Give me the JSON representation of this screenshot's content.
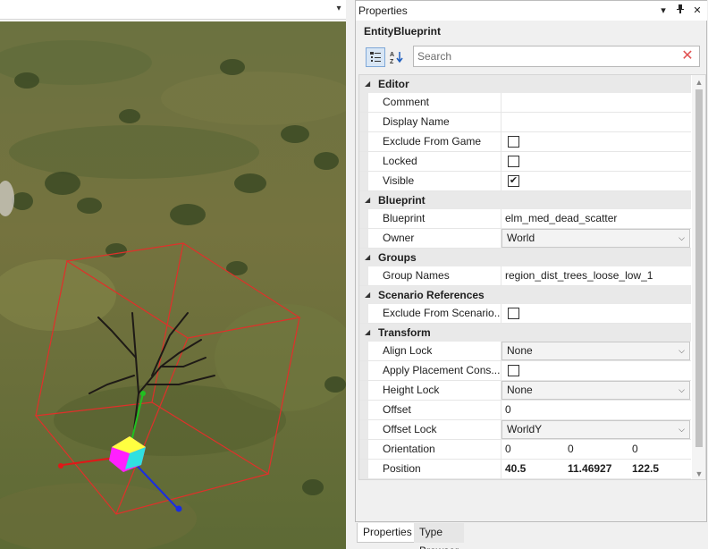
{
  "panel": {
    "title": "Properties",
    "entity_name": "EntityBlueprint",
    "search": {
      "placeholder": "Search",
      "value": ""
    },
    "icons": {
      "menu": "▾",
      "pin": "⬈",
      "close": "✕",
      "clear": "✕"
    }
  },
  "categories": [
    {
      "name": "Editor",
      "rows": [
        {
          "name": "Comment",
          "type": "text",
          "value": ""
        },
        {
          "name": "Display Name",
          "type": "text",
          "value": ""
        },
        {
          "name": "Exclude From Game",
          "type": "checkbox",
          "checked": false
        },
        {
          "name": "Locked",
          "type": "checkbox",
          "checked": false
        },
        {
          "name": "Visible",
          "type": "checkbox",
          "checked": true
        }
      ]
    },
    {
      "name": "Blueprint",
      "rows": [
        {
          "name": "Blueprint",
          "type": "text",
          "value": "elm_med_dead_scatter"
        },
        {
          "name": "Owner",
          "type": "dropdown",
          "value": "World"
        }
      ]
    },
    {
      "name": "Groups",
      "rows": [
        {
          "name": "Group Names",
          "type": "text",
          "value": "region_dist_trees_loose_low_1"
        }
      ]
    },
    {
      "name": "Scenario References",
      "rows": [
        {
          "name": "Exclude From Scenario...",
          "type": "checkbox",
          "checked": false
        }
      ]
    },
    {
      "name": "Transform",
      "rows": [
        {
          "name": "Align Lock",
          "type": "dropdown",
          "value": "None"
        },
        {
          "name": "Apply Placement Cons...",
          "type": "checkbox",
          "checked": false
        },
        {
          "name": "Height Lock",
          "type": "dropdown",
          "value": "None"
        },
        {
          "name": "Offset",
          "type": "text",
          "value": "0"
        },
        {
          "name": "Offset Lock",
          "type": "dropdown",
          "value": "WorldY"
        },
        {
          "name": "Orientation",
          "type": "vector",
          "values": [
            "0",
            "0",
            "0"
          ],
          "bold": false
        },
        {
          "name": "Position",
          "type": "vector",
          "values": [
            "40.5",
            "11.46927",
            "122.5"
          ],
          "bold": true
        }
      ]
    }
  ],
  "tabs": [
    {
      "label": "Properties",
      "active": true
    },
    {
      "label": "Type Browser",
      "active": false
    }
  ],
  "viewport": {
    "menu_icon": "▾",
    "selection_box_color": "#e0302a",
    "gizmo_colors": {
      "x": "#e01818",
      "y": "#20c020",
      "z": "#1a2ee0"
    }
  }
}
